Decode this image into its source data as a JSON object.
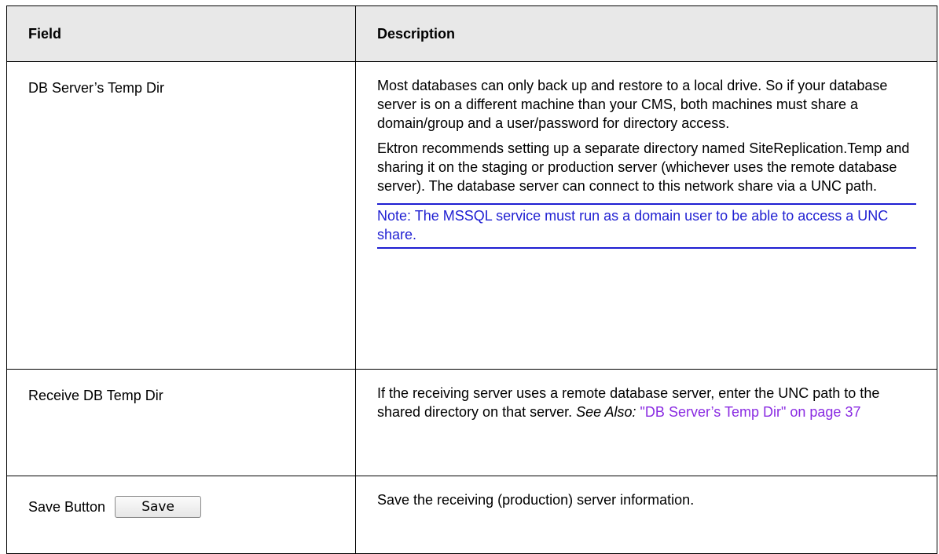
{
  "table": {
    "headers": {
      "field": "Field",
      "description": "Description"
    },
    "rows": [
      {
        "field": "DB Server’s Temp Dir",
        "paragraphs": [
          "Most databases can only back up and restore to a local drive. So if your database server is on a different machine than your CMS, both machines must share a domain/group and a user/password for directory access.",
          "Ektron recommends setting up a separate directory named SiteReplication.Temp and sharing it on the staging or production server (whichever uses the remote database server). The database server can connect to this network share via a UNC path."
        ],
        "note": "Note: The MSSQL service must run as a domain user to be able to access a UNC share."
      },
      {
        "field": "Receive DB Temp Dir",
        "text": "If the receiving server uses a remote database server, enter the UNC path to the shared directory on that server.",
        "see_also_label": "See Also:",
        "see_also_link": "\"DB Server’s Temp Dir\" on page 37"
      },
      {
        "field": "Save Button",
        "button_label": "Save",
        "description": "Save the receiving (production) server information."
      }
    ]
  }
}
